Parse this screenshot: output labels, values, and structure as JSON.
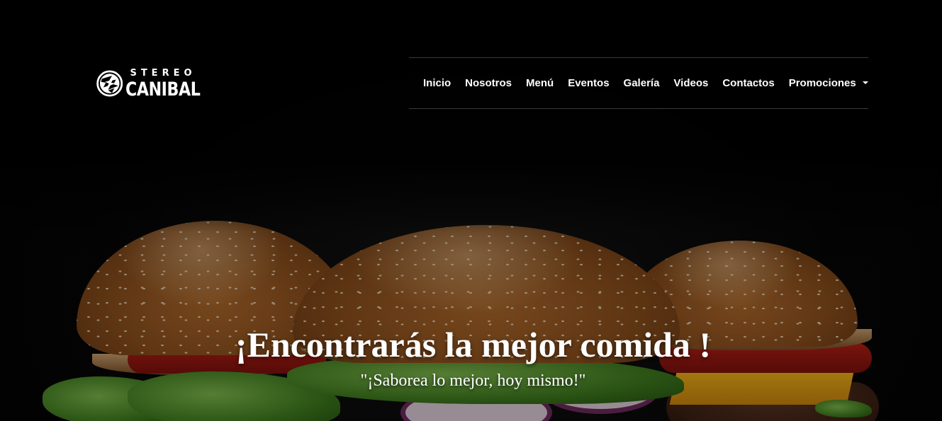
{
  "brand": {
    "name_top": "STEREO",
    "name_bottom": "CANIBAL"
  },
  "nav": {
    "items": [
      {
        "label": "Inicio"
      },
      {
        "label": "Nosotros"
      },
      {
        "label": "Menú"
      },
      {
        "label": "Eventos"
      },
      {
        "label": "Galería"
      },
      {
        "label": "Videos"
      },
      {
        "label": "Contactos"
      },
      {
        "label": "Promociones",
        "dropdown": true
      }
    ]
  },
  "hero": {
    "title": "¡Encontrarás la mejor comida !",
    "subtitle": "\"¡Saborea lo mejor, hoy mismo!\"",
    "image": "burgers-photo"
  },
  "colors": {
    "background": "#000000",
    "text": "#ffffff",
    "nav_border": "#3a3a3a"
  }
}
